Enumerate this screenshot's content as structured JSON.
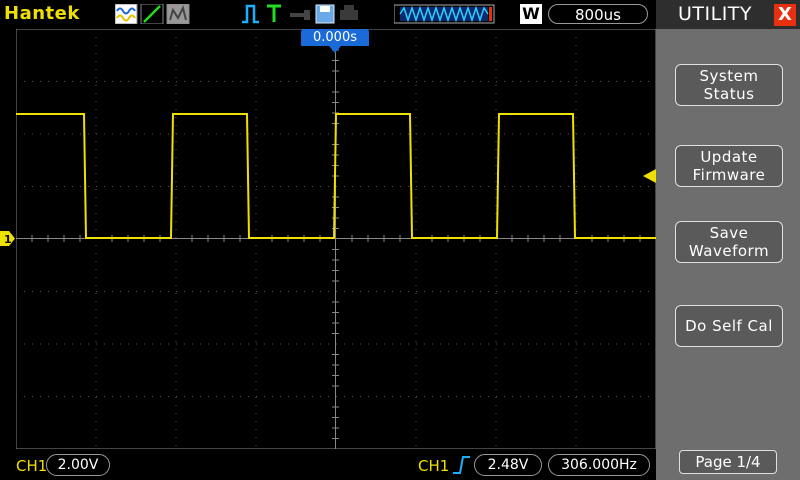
{
  "app": {
    "brand": "Hantek"
  },
  "header": {
    "timebase": "800us",
    "mode_letter": "W"
  },
  "trigger": {
    "position": "0.000s"
  },
  "utility": {
    "title": "UTILITY",
    "close": "X",
    "buttons": [
      {
        "lines": [
          "System",
          "Status"
        ]
      },
      {
        "lines": [
          "Update",
          "Firmware"
        ]
      },
      {
        "lines": [
          "Save",
          "Waveform"
        ]
      },
      {
        "lines": [
          "Do Self Cal"
        ]
      }
    ],
    "page": "Page 1/4"
  },
  "footer": {
    "ch1_label": "CH1",
    "ch1_scale": "2.00V",
    "trig_src": "CH1",
    "trig_level": "2.48V",
    "frequency": "306.000Hz"
  },
  "colors": {
    "trace": "#f0e000",
    "accent": "#1a6ad8",
    "close": "#e83010"
  }
}
